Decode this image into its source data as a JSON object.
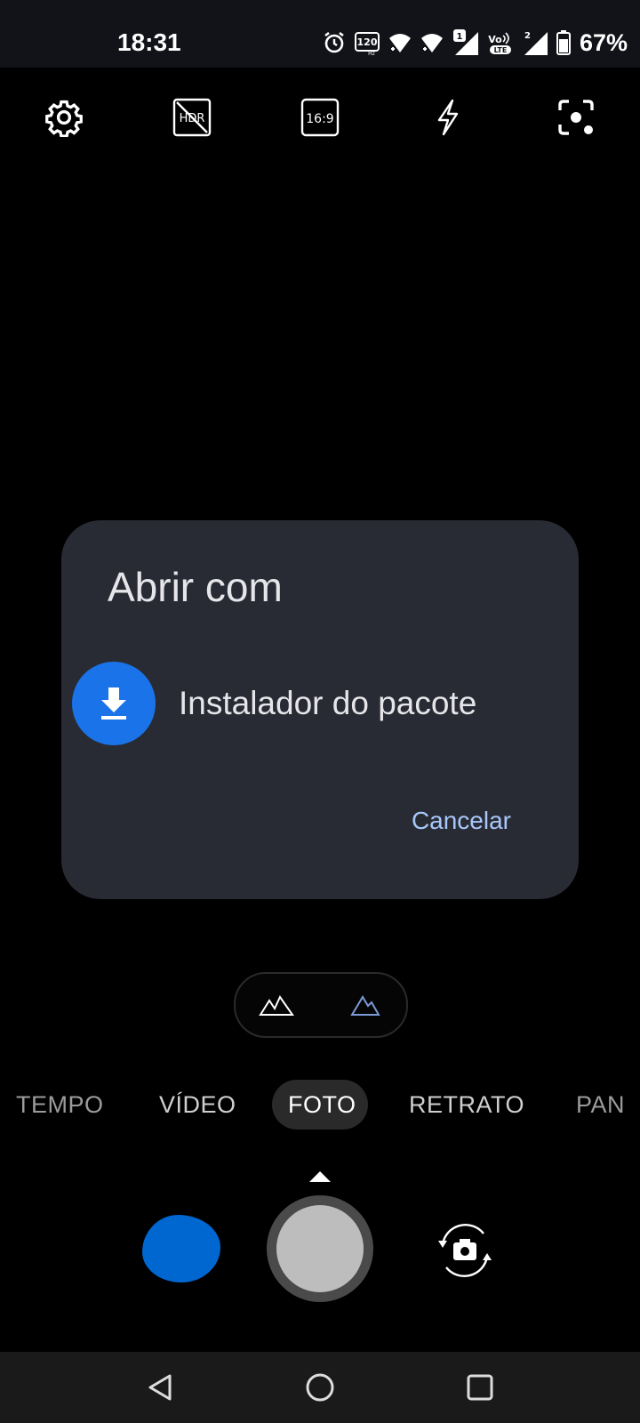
{
  "status_bar": {
    "time": "18:31",
    "refresh_rate": "120",
    "refresh_unit": "Hz",
    "sim1_badge": "1",
    "sim2_badge": "2",
    "volte_label": "Vo",
    "lte_label": "LTE",
    "battery_percent": "67%",
    "icons": [
      "alarm-icon",
      "refresh-rate-icon",
      "wifi-icon",
      "wifi-icon",
      "signal-icon",
      "volte-icon",
      "signal-icon",
      "battery-icon"
    ]
  },
  "camera_toolbar": {
    "icons": [
      "settings-icon",
      "hdr-off-icon",
      "aspect-ratio-icon",
      "flash-icon",
      "lens-icon"
    ],
    "aspect_ratio": "16:9",
    "hdr_label": "HDR"
  },
  "dialog": {
    "title": "Abrir com",
    "app_label": "Instalador do pacote",
    "app_icon": "download-icon",
    "app_icon_color": "#1a73e8",
    "cancel_label": "Cancelar",
    "cancel_color": "#a8c7fa"
  },
  "lens_toggle": {
    "icons": [
      "mountains-wide-icon",
      "mountain-icon"
    ],
    "active_color": "#7b9ad6"
  },
  "modes": {
    "items": [
      "TEMPO",
      "VÍDEO",
      "FOTO",
      "RETRATO",
      "PAN"
    ],
    "selected": "FOTO"
  },
  "capture": {
    "thumbnail_color": "#0066d0",
    "shutter": "shutter-button",
    "switch_camera": "switch-camera-icon"
  },
  "nav_bar": {
    "icons": [
      "back-icon",
      "home-icon",
      "recents-icon"
    ]
  }
}
